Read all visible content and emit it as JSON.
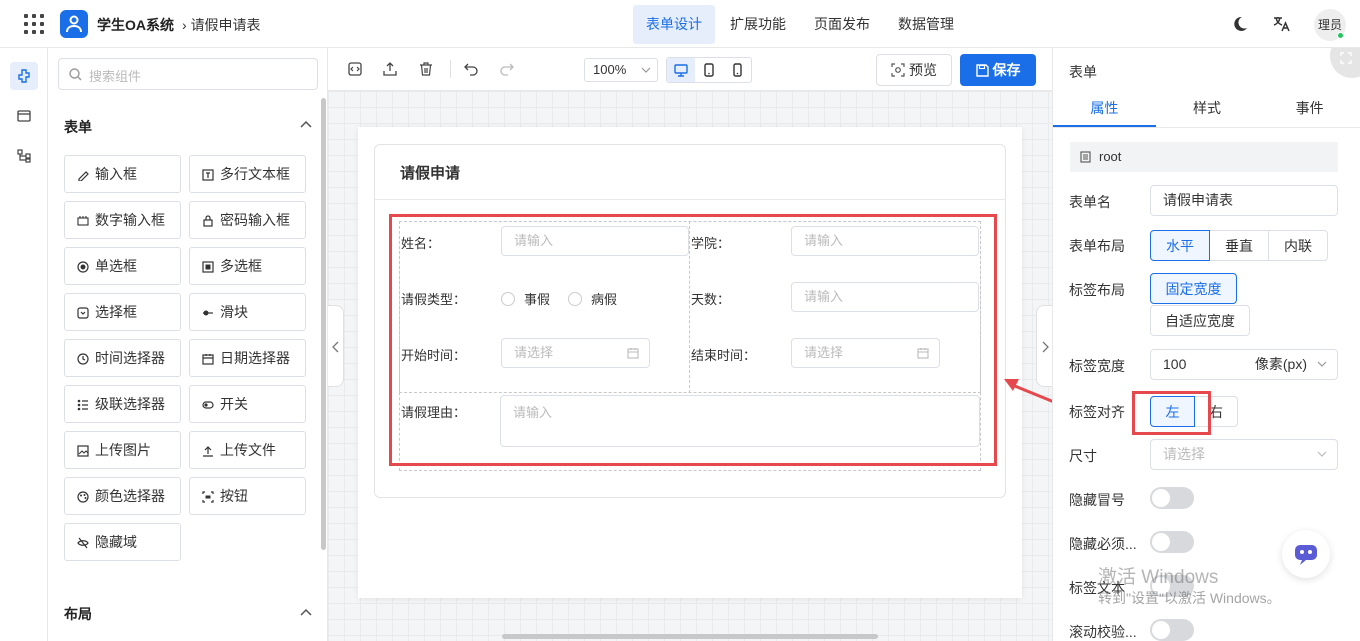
{
  "header": {
    "app_name": "学生OA系统",
    "breadcrumb": "请假申请表",
    "nav": [
      "表单设计",
      "扩展功能",
      "页面发布",
      "数据管理"
    ],
    "active_nav": "表单设计",
    "user": "理员"
  },
  "components": {
    "search_placeholder": "搜索组件",
    "section_form": "表单",
    "items": [
      {
        "label": "输入框",
        "icon": "pencil-icon"
      },
      {
        "label": "多行文本框",
        "icon": "textarea-icon"
      },
      {
        "label": "数字输入框",
        "icon": "number-icon"
      },
      {
        "label": "密码输入框",
        "icon": "lock-icon"
      },
      {
        "label": "单选框",
        "icon": "radio-icon"
      },
      {
        "label": "多选框",
        "icon": "checkbox-icon"
      },
      {
        "label": "选择框",
        "icon": "select-icon"
      },
      {
        "label": "滑块",
        "icon": "slider-icon"
      },
      {
        "label": "时间选择器",
        "icon": "clock-icon"
      },
      {
        "label": "日期选择器",
        "icon": "calendar-icon"
      },
      {
        "label": "级联选择器",
        "icon": "cascader-icon"
      },
      {
        "label": "开关",
        "icon": "switch-icon"
      },
      {
        "label": "上传图片",
        "icon": "image-icon"
      },
      {
        "label": "上传文件",
        "icon": "upload-icon"
      },
      {
        "label": "颜色选择器",
        "icon": "palette-icon"
      },
      {
        "label": "按钮",
        "icon": "button-icon"
      },
      {
        "label": "隐藏域",
        "icon": "eye-off-icon"
      }
    ],
    "section_layout": "布局"
  },
  "toolbar": {
    "zoom": "100%",
    "preview": "预览",
    "save": "保存"
  },
  "form": {
    "title": "请假申请",
    "fields": {
      "name_label": "姓名：",
      "name_placeholder": "请输入",
      "college_label": "学院：",
      "college_placeholder": "请输入",
      "type_label": "请假类型：",
      "type_options": [
        "事假",
        "病假"
      ],
      "days_label": "天数：",
      "days_placeholder": "请输入",
      "start_label": "开始时间：",
      "start_placeholder": "请选择",
      "end_label": "结束时间：",
      "end_placeholder": "请选择",
      "reason_label": "请假理由：",
      "reason_placeholder": "请输入"
    }
  },
  "props": {
    "panel_title": "表单",
    "tabs": [
      "属性",
      "样式",
      "事件"
    ],
    "active_tab": "属性",
    "root": "root",
    "form_name_label": "表单名",
    "form_name_value": "请假申请表",
    "form_layout_label": "表单布局",
    "form_layout_options": [
      "水平",
      "垂直",
      "内联"
    ],
    "label_layout_label": "标签布局",
    "label_layout_options": [
      "固定宽度",
      "自适应宽度"
    ],
    "label_width_label": "标签宽度",
    "label_width_value": "100",
    "label_width_unit": "像素(px)",
    "label_align_label": "标签对齐",
    "label_align_options": [
      "左",
      "右"
    ],
    "size_label": "尺寸",
    "size_placeholder": "请选择",
    "hide_colon_label": "隐藏冒号",
    "hide_required_label": "隐藏必须...",
    "label_text_label": "标签文本",
    "scroll_validate_label": "滚动校验..."
  },
  "watermark": {
    "line1": "激活 Windows",
    "line2": "转到\"设置\"以激活 Windows。"
  },
  "colors": {
    "accent": "#1a6fe8",
    "highlight": "#e5484d"
  }
}
